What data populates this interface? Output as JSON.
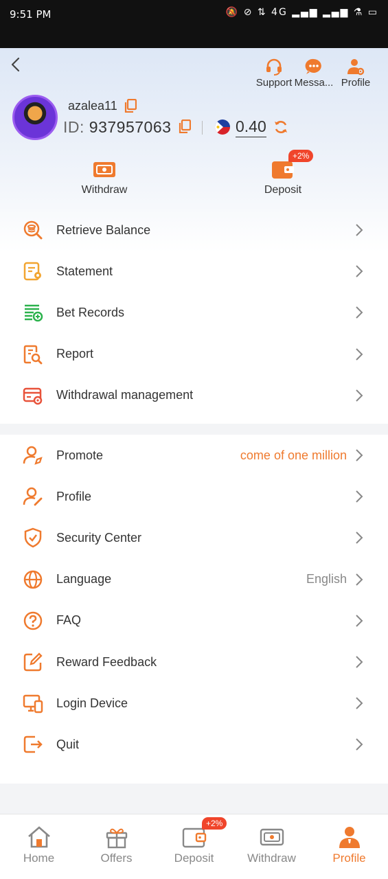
{
  "status_bar": {
    "time": "9:51 PM",
    "icons": "🔕 ⊘ ⇅ 4G ▂▄▆ ▂▄▆ ⚗ ▭"
  },
  "header": {
    "actions": [
      {
        "label": "Support",
        "icon": "headset-icon"
      },
      {
        "label": "Messa...",
        "icon": "message-icon"
      },
      {
        "label": "Profile",
        "icon": "user-settings-icon"
      }
    ],
    "username": "azalea11",
    "id_label": "ID:",
    "id_value": "937957063",
    "balance": "0.40",
    "quick_actions": {
      "withdraw": "Withdraw",
      "deposit": "Deposit",
      "deposit_badge": "+2%"
    }
  },
  "menu1": [
    {
      "label": "Retrieve Balance",
      "icon": "retrieve-balance-icon"
    },
    {
      "label": "Statement",
      "icon": "statement-icon"
    },
    {
      "label": "Bet Records",
      "icon": "bet-records-icon"
    },
    {
      "label": "Report",
      "icon": "report-icon"
    },
    {
      "label": "Withdrawal management",
      "icon": "withdrawal-management-icon"
    }
  ],
  "menu2": [
    {
      "label": "Promote",
      "icon": "promote-icon",
      "extra": "come of one million"
    },
    {
      "label": "Profile",
      "icon": "profile-icon"
    },
    {
      "label": "Security Center",
      "icon": "security-shield-icon"
    },
    {
      "label": "Language",
      "icon": "globe-icon",
      "extra": "English"
    },
    {
      "label": "FAQ",
      "icon": "question-icon"
    },
    {
      "label": "Reward Feedback",
      "icon": "edit-feedback-icon"
    },
    {
      "label": "Login Device",
      "icon": "device-icon"
    },
    {
      "label": "Quit",
      "icon": "logout-icon"
    }
  ],
  "tabbar": [
    {
      "label": "Home",
      "icon": "home-icon"
    },
    {
      "label": "Offers",
      "icon": "gift-icon"
    },
    {
      "label": "Deposit",
      "icon": "wallet-icon",
      "badge": "+2%"
    },
    {
      "label": "Withdraw",
      "icon": "cash-icon"
    },
    {
      "label": "Profile",
      "icon": "user-icon",
      "active": true
    }
  ],
  "colors": {
    "accent": "#ef7a2e",
    "badge": "#f0452b",
    "green": "#2bb24c",
    "gold": "#f2a531",
    "red": "#e8523a"
  }
}
